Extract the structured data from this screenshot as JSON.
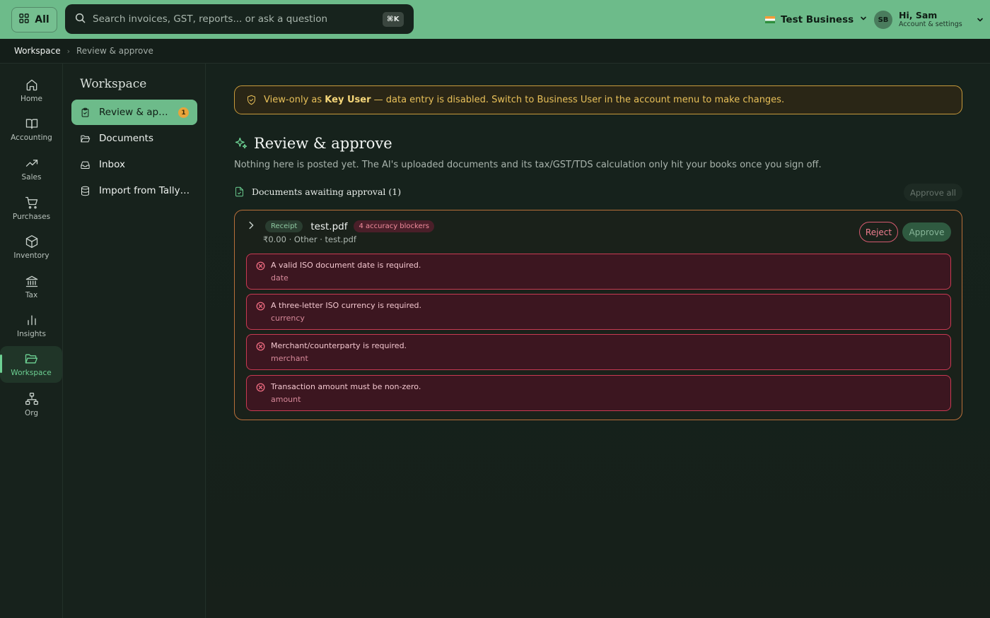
{
  "topbar": {
    "all_label": "All",
    "search_placeholder": "Search invoices, GST, reports... or ask a question",
    "shortcut": "⌘K",
    "business_name": "Test Business",
    "user_initials": "SB",
    "user_greeting": "Hi, Sam",
    "user_sub": "Account & settings"
  },
  "breadcrumb": {
    "root": "Workspace",
    "current": "Review & approve"
  },
  "rail": [
    {
      "label": "Home",
      "icon": "home-icon"
    },
    {
      "label": "Accounting",
      "icon": "book-icon"
    },
    {
      "label": "Sales",
      "icon": "trending-up-icon"
    },
    {
      "label": "Purchases",
      "icon": "cart-icon"
    },
    {
      "label": "Inventory",
      "icon": "box-icon"
    },
    {
      "label": "Tax",
      "icon": "bank-icon"
    },
    {
      "label": "Insights",
      "icon": "bar-chart-icon"
    },
    {
      "label": "Workspace",
      "icon": "folder-open-icon",
      "active": true
    },
    {
      "label": "Org",
      "icon": "org-chart-icon"
    }
  ],
  "sidebar": {
    "title": "Workspace",
    "items": [
      {
        "label": "Review & appr...",
        "badge": "1",
        "active": true
      },
      {
        "label": "Documents"
      },
      {
        "label": "Inbox"
      },
      {
        "label": "Import from Tally/..."
      }
    ]
  },
  "banner": {
    "prefix": "View-only as ",
    "role": "Key User",
    "suffix": " — data entry is disabled. Switch to Business User in the account menu to make changes."
  },
  "page": {
    "title": "Review & approve",
    "description": "Nothing here is posted yet. The AI's uploaded documents and its tax/GST/TDS calculation only hit your books once you sign off.",
    "section_title": "Documents awaiting approval (1)",
    "approve_all": "Approve all"
  },
  "document": {
    "type": "Receipt",
    "filename": "test.pdf",
    "blockers": "4 accuracy blockers",
    "meta": "₹0.00 · Other · test.pdf",
    "reject_label": "Reject",
    "approve_label": "Approve",
    "errors": [
      {
        "message": "A valid ISO document date is required.",
        "field": "date"
      },
      {
        "message": "A three-letter ISO currency is required.",
        "field": "currency"
      },
      {
        "message": "Merchant/counterparty is required.",
        "field": "merchant"
      },
      {
        "message": "Transaction amount must be non-zero.",
        "field": "amount"
      }
    ]
  },
  "colors": {
    "topbar": "#6dbb8a",
    "background": "#16221c",
    "accent": "#6dd193",
    "warning": "#e8c059",
    "error": "#c83a52"
  }
}
